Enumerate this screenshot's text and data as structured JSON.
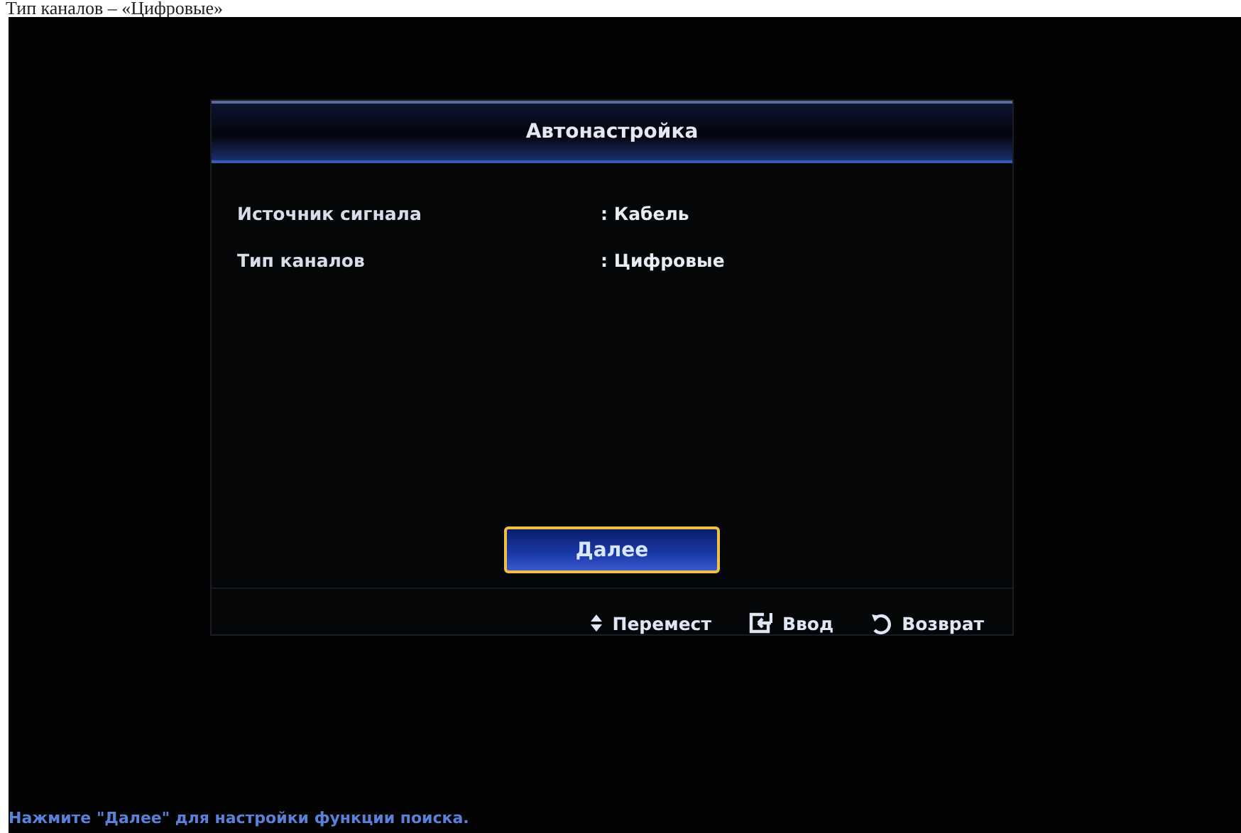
{
  "caption": "Тип каналов – «Цифровые»",
  "dialog": {
    "title": "Автонастройка",
    "rows": [
      {
        "label": "Источник сигнала",
        "value": ": Кабель"
      },
      {
        "label": "Тип каналов",
        "value": ": Цифровые"
      }
    ],
    "button": {
      "label": "Далее",
      "selected": true
    },
    "hints": [
      {
        "kind": "move",
        "label": "Перемест"
      },
      {
        "kind": "enter",
        "label": "Ввод"
      },
      {
        "kind": "return",
        "label": "Возврат"
      }
    ]
  },
  "status": "Нажмите \"Далее\" для настройки функции поиска."
}
